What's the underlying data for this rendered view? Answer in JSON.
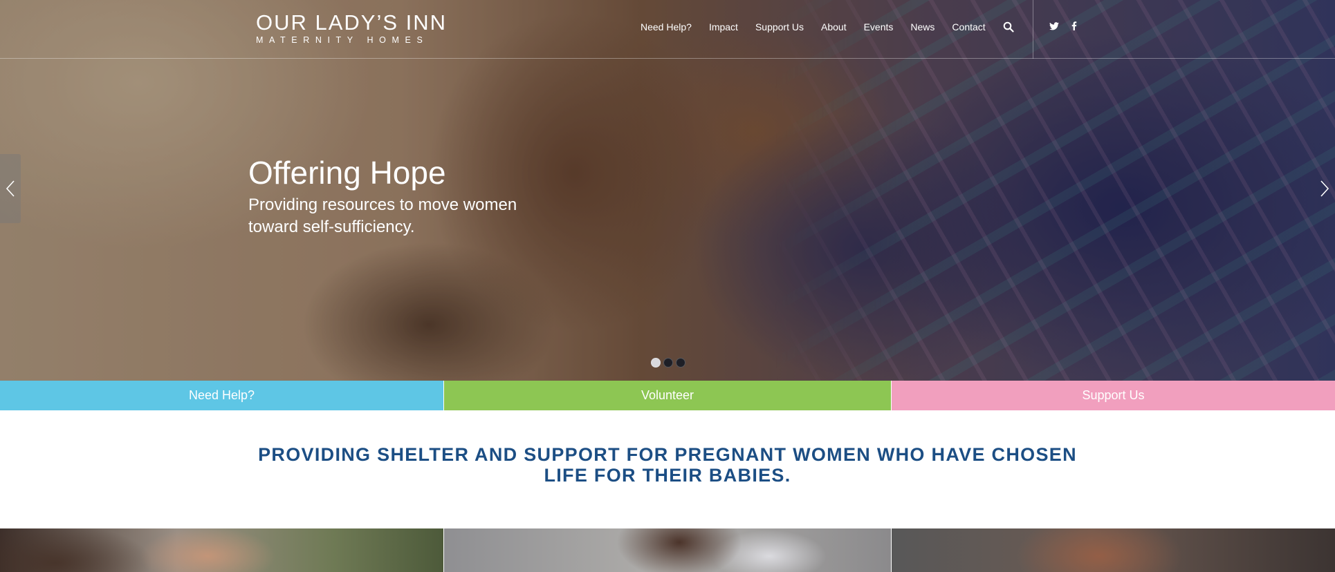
{
  "header": {
    "logo_main": "OUR LADY’S INN",
    "logo_sub": "MATERNITY HOMES",
    "nav": [
      {
        "label": "Need Help?"
      },
      {
        "label": "Impact"
      },
      {
        "label": "Support Us"
      },
      {
        "label": "About"
      },
      {
        "label": "Events"
      },
      {
        "label": "News"
      },
      {
        "label": "Contact"
      }
    ],
    "search_icon": "search-icon",
    "social": [
      "twitter-icon",
      "facebook-icon"
    ]
  },
  "hero": {
    "title": "Offering Hope",
    "subtitle": "Providing resources to move women toward self-sufficiency.",
    "slides": 3,
    "active_slide": 1
  },
  "cta": [
    {
      "label": "Need Help?",
      "color": "#5ec6e5"
    },
    {
      "label": "Volunteer",
      "color": "#8dc653"
    },
    {
      "label": "Support Us",
      "color": "#f19fbe"
    }
  ],
  "tagline": "PROVIDING SHELTER AND SUPPORT FOR PREGNANT WOMEN WHO HAVE CHOSEN LIFE FOR THEIR BABIES.",
  "colors": {
    "tagline": "#1c4e84",
    "need_help": "#5ec6e5",
    "volunteer": "#8dc653",
    "support_us": "#f19fbe"
  }
}
